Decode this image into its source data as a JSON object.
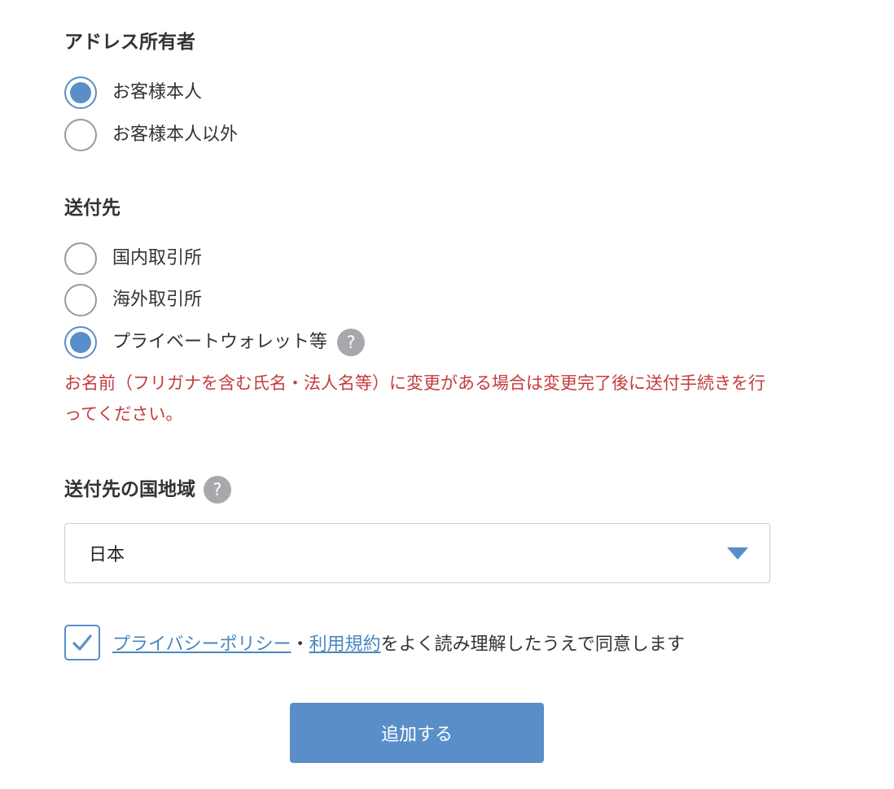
{
  "owner": {
    "title": "アドレス所有者",
    "options": [
      {
        "label": "お客様本人",
        "checked": true
      },
      {
        "label": "お客様本人以外",
        "checked": false
      }
    ]
  },
  "destination": {
    "title": "送付先",
    "options": [
      {
        "label": "国内取引所",
        "checked": false
      },
      {
        "label": "海外取引所",
        "checked": false
      },
      {
        "label": "プライベートウォレット等",
        "checked": true
      }
    ],
    "help": "?",
    "notice": "お名前（フリガナを含む氏名・法人名等）に変更がある場合は変更完了後に送付手続きを行ってください。"
  },
  "country": {
    "title": "送付先の国地域",
    "help": "?",
    "selected": "日本"
  },
  "agreement": {
    "checked": true,
    "privacy_link": "プライバシーポリシー",
    "separator": "・",
    "terms_link": "利用規約",
    "text": "をよく読み理解したうえで同意します"
  },
  "submit_label": "追加する",
  "colors": {
    "accent": "#5a8ec8",
    "error": "#c43c3c",
    "help_icon": "#a6a8ab"
  }
}
